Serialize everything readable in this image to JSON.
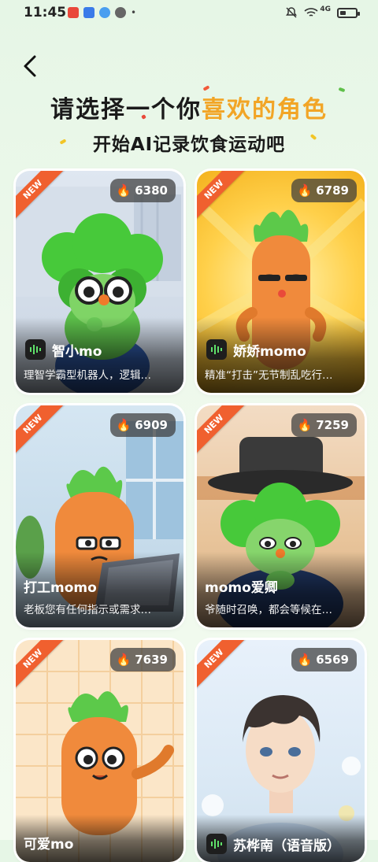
{
  "status": {
    "time": "11:45",
    "network": "4G"
  },
  "header": {
    "title_prefix": "请选择一个你",
    "title_highlight": "喜欢的角色",
    "subtitle": "开始AI记录饮食运动吧"
  },
  "colors": {
    "highlight": "#f2a526",
    "badge_new": "#f0602f",
    "broccoli": "#47c93a",
    "carrot": "#f08a3c"
  },
  "cards": [
    {
      "name": "智小mo",
      "desc": "理智学霸型机器人，逻辑…",
      "hot": "6380",
      "badge": "NEW",
      "voice": true
    },
    {
      "name": "娇娇momo",
      "desc": "精准“打击”无节制乱吃行…",
      "hot": "6789",
      "badge": "NEW",
      "voice": true
    },
    {
      "name": "打工momo",
      "desc": "老板您有任何指示或需求…",
      "hot": "6909",
      "badge": "NEW",
      "voice": false
    },
    {
      "name": "momo爱卿",
      "desc": "爷随时召唤，都会等候在…",
      "hot": "7259",
      "badge": "NEW",
      "voice": false
    },
    {
      "name": "可爱mo",
      "desc": "",
      "hot": "7639",
      "badge": "NEW",
      "voice": false
    },
    {
      "name": "苏桦南（语音版）",
      "desc": "",
      "hot": "6569",
      "badge": "NEW",
      "voice": true
    }
  ]
}
